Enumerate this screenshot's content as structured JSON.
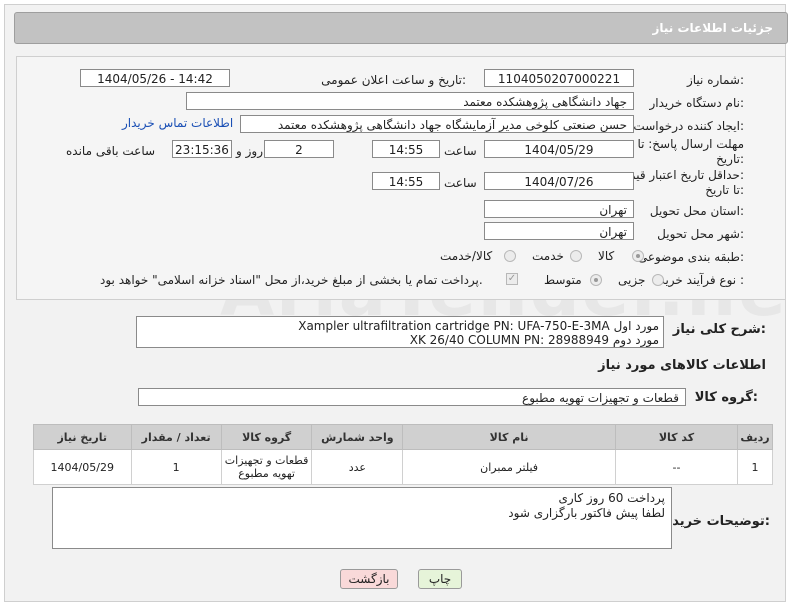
{
  "header": {
    "title": "جزئیات اطلاعات نیاز"
  },
  "form": {
    "need_number_label": "شماره نیاز:",
    "need_number": "1104050207000221",
    "announce_label": "تاریخ و ساعت اعلان عمومی:",
    "announce_value": "1404/05/26 - 14:42",
    "buyer_org_label": "نام دستگاه خریدار:",
    "buyer_org": "جهاد دانشگاهی پژوهشکده معتمد",
    "creator_label": "ایجاد کننده درخواست:",
    "creator": "حسن صنعتی کلوخی مدیر آزمایشگاه جهاد دانشگاهی پژوهشکده معتمد",
    "contact_link": "اطلاعات تماس خریدار",
    "deadline_label_1": "مهلت ارسال پاسخ: تا",
    "deadline_label_2": "تاریخ:",
    "deadline_date": "1404/05/29",
    "time_label": "ساعت",
    "deadline_time": "14:55",
    "days_value": "2",
    "days_label": "روز و",
    "remaining_time": "23:15:36",
    "remaining_label": "ساعت باقی مانده",
    "validity_label_1": "حداقل تاریخ اعتبار قیمت:",
    "validity_label_2": "تا تاریخ:",
    "validity_date": "1404/07/26",
    "validity_time": "14:55",
    "province_label": "استان محل تحویل:",
    "province": "تهران",
    "city_label": "شهر محل تحویل:",
    "city": "تهران",
    "category_label": "طبقه بندی موضوعی:",
    "category_options": [
      "کالا",
      "خدمت",
      "کالا/خدمت"
    ],
    "process_label": "نوع فرآیند خرید :",
    "process_options": [
      "جزیی",
      "متوسط"
    ],
    "payment_note": "پرداخت تمام یا بخشی از مبلغ خرید،از محل \"اسناد خزانه اسلامی\" خواهد بود."
  },
  "description": {
    "label": "شرح کلی نیاز:",
    "line1": "مورد اول Xampler ultrafiltration cartridge PN: UFA-750-E-3MA",
    "line2": "مورد دوم XK 26/40 COLUMN PN: 28988949"
  },
  "goods": {
    "section_title": "اطلاعات کالاهای مورد نیاز",
    "group_label": "گروه کالا:",
    "group_value": "قطعات و تجهیزات تهویه مطبوع",
    "columns": [
      "ردیف",
      "کد کالا",
      "نام کالا",
      "واحد شمارش",
      "گروه کالا",
      "تعداد / مقدار",
      "تاریخ نیاز"
    ],
    "rows": [
      {
        "row": "1",
        "code": "--",
        "name": "فیلتر ممبران",
        "unit": "عدد",
        "group_line1": "قطعات و تجهیزات",
        "group_line2": "تهویه مطبوع",
        "qty": "1",
        "date": "1404/05/29"
      }
    ]
  },
  "buyer_notes": {
    "label": "توضیحات خریدار:",
    "line1": "پرداخت 60 روز کاری",
    "line2": "لطفا پیش فاکتور بارگزاری شود"
  },
  "buttons": {
    "print": "چاپ",
    "back": "بازگشت"
  },
  "watermark": "AriaTender.neT",
  "colors": {
    "header_bg": "#c2c2c2",
    "link": "#1a4fb5",
    "back_button": "#f9d9d9",
    "print_button": "#e6f4d9"
  }
}
